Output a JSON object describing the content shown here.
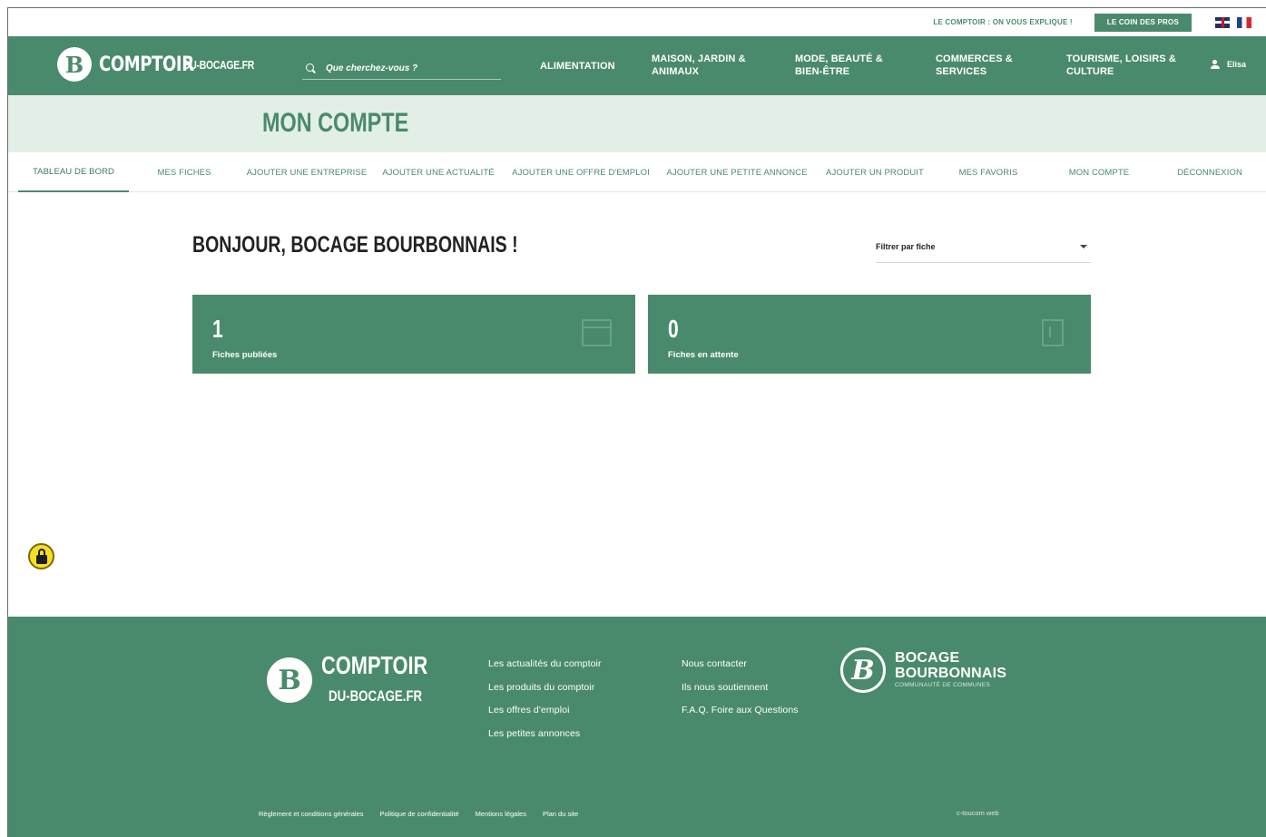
{
  "topbar": {
    "explainer_link": "LE COMPTOIR : ON VOUS EXPLIQUE !",
    "pros_button": "LE COIN DES PROS",
    "flags": [
      "english-flag-icon",
      "french-flag-icon"
    ]
  },
  "header": {
    "logo_mark": "B",
    "logo_main": "COMPTOIR",
    "logo_sub": "DU-BOCAGE.FR",
    "search_placeholder": "Que cherchez-vous ?",
    "nav": [
      {
        "line1": "ALIMENTATION",
        "line2": ""
      },
      {
        "line1": "MAISON, JARDIN &",
        "line2": "ANIMAUX"
      },
      {
        "line1": "MODE, BEAUTÉ &",
        "line2": "BIEN-ÊTRE"
      },
      {
        "line1": "COMMERCES &",
        "line2": "SERVICES"
      },
      {
        "line1": "TOURISME, LOISIRS &",
        "line2": "CULTURE"
      }
    ],
    "user_name": "Elisa"
  },
  "page": {
    "title": "MON COMPTE"
  },
  "subnav": [
    "TABLEAU DE BORD",
    "MES FICHES",
    "AJOUTER UNE ENTREPRISE",
    "AJOUTER UNE ACTUALITÉ",
    "AJOUTER UNE OFFRE D'EMPLOI",
    "AJOUTER UNE PETITE ANNONCE",
    "AJOUTER UN PRODUIT",
    "MES FAVORIS",
    "MON COMPTE",
    "DÉCONNEXION"
  ],
  "dashboard": {
    "greeting": "BONJOUR, BOCAGE BOURBONNAIS !",
    "filter_label": "Filtrer par fiche",
    "cards": [
      {
        "value": "1",
        "label": "Fiches publiées",
        "icon": "browser-window-icon"
      },
      {
        "value": "0",
        "label": "Fiches en attente",
        "icon": "door-icon"
      }
    ]
  },
  "footer": {
    "logo_main": "COMPTOIR",
    "logo_sub": "DU-BOCAGE.FR",
    "col1": [
      "Les actualités du comptoir",
      "Les produits du comptoir",
      "Les offres d'emploi",
      "Les petites annonces"
    ],
    "col2": [
      "Nous contacter",
      "Ils nous soutiennent",
      "F.A.Q. Foire aux Questions"
    ],
    "partner_mark": "B",
    "partner_line1": "BOCAGE",
    "partner_line2": "BOURBONNAIS",
    "partner_tag": "COMMUNAUTÉ DE COMMUNES",
    "legal": [
      "Règlement et conditions générales",
      "Politique de confidentialité",
      "Mentions légales",
      "Plan du site"
    ],
    "credit": "c-toucom web"
  },
  "colors": {
    "brand_green": "#4a8a6c",
    "light_green": "#e2efe7",
    "lock_yellow": "#f3de2a"
  }
}
